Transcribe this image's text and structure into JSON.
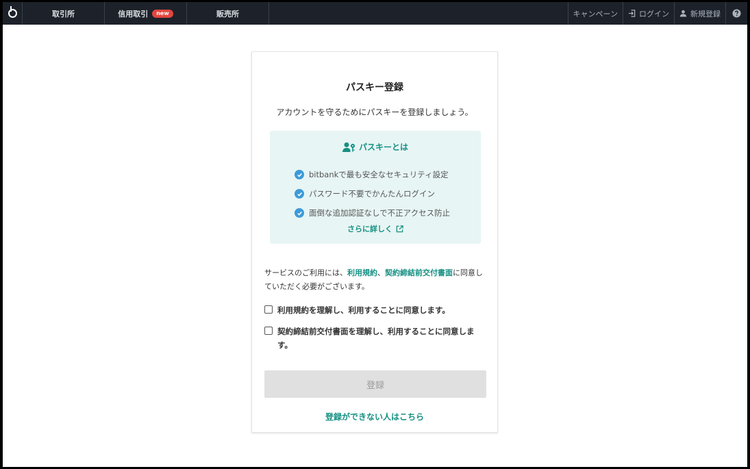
{
  "nav": {
    "tabs": [
      {
        "label": "取引所"
      },
      {
        "label": "信用取引",
        "badge": "new"
      },
      {
        "label": "販売所"
      }
    ],
    "campaign": "キャンペーン",
    "login": "ログイン",
    "signup": "新規登録"
  },
  "card": {
    "title": "パスキー登録",
    "subtitle": "アカウントを守るためにパスキーを登録しましょう。",
    "info": {
      "heading": "パスキーとは",
      "items": [
        "bitbankで最も安全なセキュリティ設定",
        "パスワード不要でかんたんログイン",
        "面倒な追加認証なしで不正アクセス防止"
      ],
      "more_link": "さらに詳しく"
    },
    "terms": {
      "prefix": "サービスのご利用には、",
      "link1": "利用規約",
      "sep": "、",
      "link2": "契約締結前交付書面",
      "suffix": "に同意していただく必要がございます。"
    },
    "agree1": "利用規約を理解し、利用することに同意します。",
    "agree2": "契約締結前交付書面を理解し、利用することに同意します。",
    "submit_label": "登録",
    "help_link": "登録ができない人はこちら"
  },
  "colors": {
    "accent": "#159083",
    "nav_bg": "#1d222a",
    "info_bg": "#e7f5f4",
    "check": "#3d9bd9",
    "badge": "#e2463f"
  }
}
